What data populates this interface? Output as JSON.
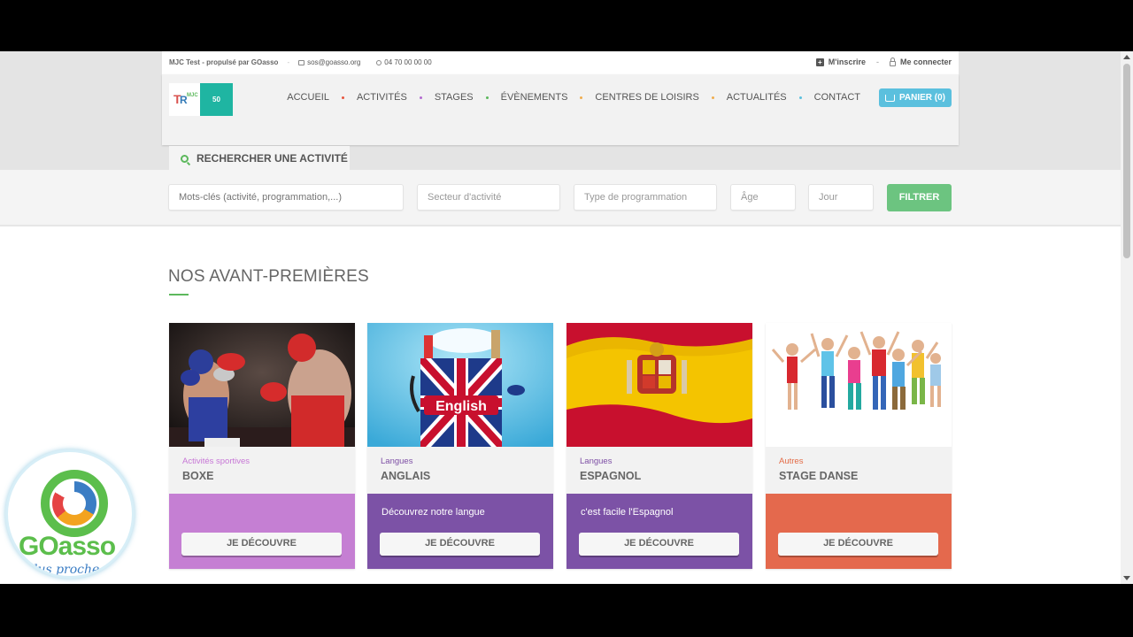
{
  "topbar": {
    "site": "MJC Test - propulsé par GOasso",
    "email": "sos@goasso.org",
    "phone": "04 70 00 00 00",
    "register": "M'inscrire",
    "login": "Me connecter"
  },
  "logo": {
    "badge_text": "50"
  },
  "nav": {
    "items": [
      "ACCUEIL",
      "ACTIVITÉS",
      "STAGES",
      "ÉVÈNEMENTS",
      "CENTRES DE LOISIRS",
      "ACTUALITÉS",
      "CONTACT"
    ],
    "dot_colors": [
      "#e8553e",
      "#b36bd0",
      "#5cb85c",
      "#f0ad4e",
      "#f0ad4e",
      "#5bc0de"
    ],
    "cart": "PANIER (0)"
  },
  "search": {
    "tab_label": "RECHERCHER UNE ACTIVITÉ",
    "keywords_placeholder": "Mots-clés (activité, programmation,...)",
    "sector_placeholder": "Secteur d'activité",
    "type_placeholder": "Type de programmation",
    "age_placeholder": "Âge",
    "day_placeholder": "Jour",
    "filter_button": "FILTRER"
  },
  "section": {
    "title": "NOS AVANT-PREMIÈRES"
  },
  "cards": [
    {
      "category": "Activités sportives",
      "category_color": "#c777d6",
      "name": "BOXE",
      "description": "",
      "bottom_color": "#c57fd3",
      "button": "JE DÉCOUVRE"
    },
    {
      "category": "Langues",
      "category_color": "#7d4fa5",
      "name": "ANGLAIS",
      "description": "Découvrez notre langue",
      "bottom_color": "#7c52a6",
      "button": "JE DÉCOUVRE"
    },
    {
      "category": "Langues",
      "category_color": "#7d4fa5",
      "name": "ESPAGNOL",
      "description": "c'est facile l'Espagnol",
      "bottom_color": "#7c52a6",
      "button": "JE DÉCOUVRE"
    },
    {
      "category": "Autres",
      "category_color": "#e36b46",
      "name": "STAGE DANSE",
      "description": "",
      "bottom_color": "#e4694d",
      "button": "JE DÉCOUVRE"
    }
  ],
  "anglais_image_text": "English",
  "goasso": {
    "brand_go": "GO",
    "brand_asso": "asso",
    "slogan": "plus proche de"
  }
}
